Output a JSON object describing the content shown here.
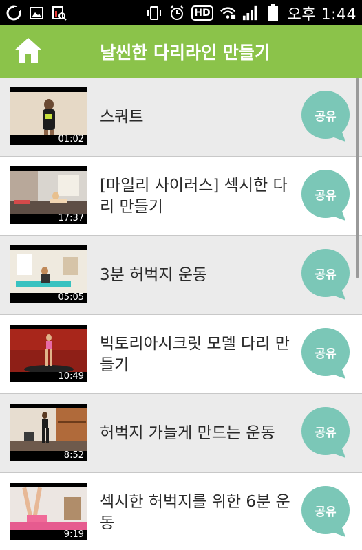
{
  "status_bar": {
    "time": "오후 1:44",
    "hd_label": "HD",
    "icons": [
      "camera-app-icon",
      "gallery-icon",
      "screenshot-search-icon",
      "vibrate-icon",
      "alarm-icon",
      "hd-voice-icon",
      "wifi-lock-icon",
      "signal-icon",
      "battery-icon"
    ]
  },
  "header": {
    "title": "날씬한 다리라인 만들기",
    "home_icon": "home-icon"
  },
  "colors": {
    "header_bg": "#8bc34a",
    "share_bubble": "#7bc7b7",
    "row_alt_bg": "#ebebeb"
  },
  "videos": [
    {
      "title": "스쿼트",
      "duration": "01:02",
      "share_label": "공유"
    },
    {
      "title": "[마일리 사이러스] 섹시한 다리 만들기",
      "duration": "17:37",
      "share_label": "공유"
    },
    {
      "title": "3분 허벅지 운동",
      "duration": "05:05",
      "share_label": "공유"
    },
    {
      "title": "빅토리아시크릿 모델 다리 만들기",
      "duration": "10:49",
      "share_label": "공유"
    },
    {
      "title": "허벅지 가늘게 만드는 운동",
      "duration": "8:52",
      "share_label": "공유"
    },
    {
      "title": "섹시한 허벅지를 위한 6분 운동",
      "duration": "9:19",
      "share_label": "공유"
    }
  ]
}
